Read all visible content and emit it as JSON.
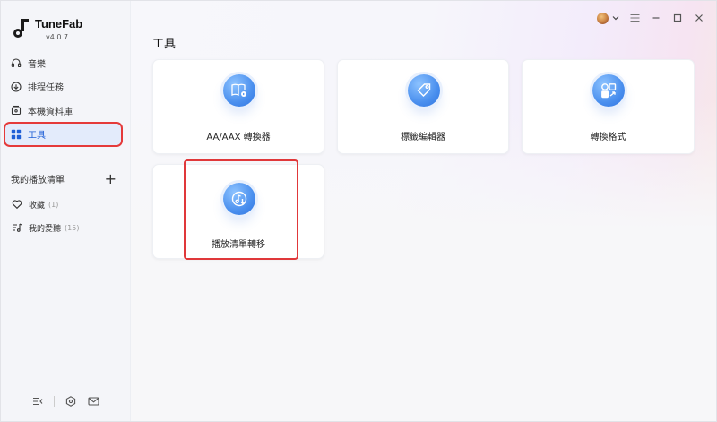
{
  "app": {
    "name": "TuneFab",
    "version": "v4.0.7"
  },
  "sidebar": {
    "nav": [
      {
        "label": "音樂",
        "icon": "headphones-icon"
      },
      {
        "label": "排程任務",
        "icon": "download-circle-icon"
      },
      {
        "label": "本機資料庫",
        "icon": "library-icon"
      },
      {
        "label": "工具",
        "icon": "grid-icon",
        "active": true
      }
    ],
    "playlists_header": "我的播放清單",
    "add_label": "+",
    "playlists": [
      {
        "label": "收藏",
        "count": "(1)",
        "icon": "heart-icon"
      },
      {
        "label": "我的愛聽",
        "count": "(15)",
        "icon": "music-list-icon"
      }
    ]
  },
  "main": {
    "title": "工具",
    "tools": [
      {
        "label": "AA/AAX 轉換器",
        "icon": "book-convert-icon"
      },
      {
        "label": "標籤編輯器",
        "icon": "tag-icon"
      },
      {
        "label": "轉換格式",
        "icon": "format-convert-icon"
      },
      {
        "label": "播放清單轉移",
        "icon": "playlist-transfer-icon"
      }
    ]
  },
  "colors": {
    "accent": "#1f5fd6",
    "highlight_red": "#e0383a",
    "icon_blue": "#4a8fee"
  }
}
